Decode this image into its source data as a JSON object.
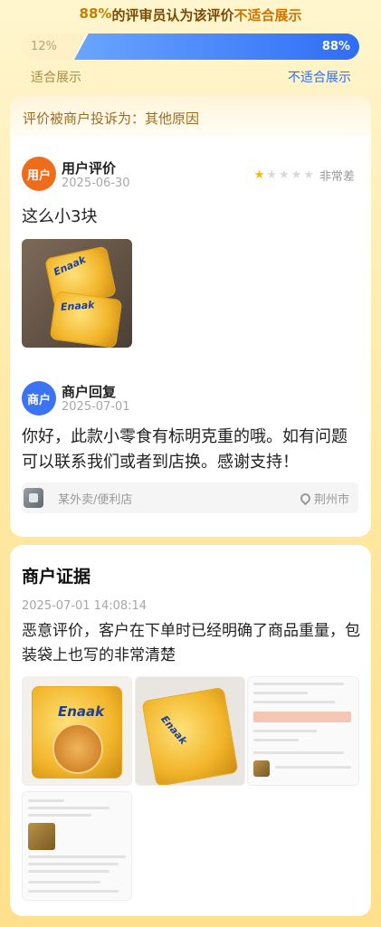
{
  "summary": {
    "percent": "88%",
    "middle": "的评审员认为该评价",
    "verdict": "不适合展示"
  },
  "vote": {
    "suitable_percent": "12%",
    "unsuitable_percent": "88%",
    "suitable_fraction": 0.12,
    "unsuitable_fraction": 0.88,
    "suitable_label": "适合展示",
    "unsuitable_label": "不适合展示",
    "left_color": "#fff1c7",
    "right_color": "#2f6df5"
  },
  "complaint": {
    "header": "评价被商户投诉为：其他原因"
  },
  "user_review": {
    "avatar_text": "用户",
    "title": "用户评价",
    "date": "2025-06-30",
    "rating": 1,
    "rating_max": 5,
    "rating_text": "非常差",
    "text": "这么小3块",
    "photo_icon": "snack-pack-photo"
  },
  "merchant_reply": {
    "avatar_text": "商户",
    "title": "商户回复",
    "date": "2025-07-01",
    "text": "你好，此款小零食有标明克重的哦。如有问题可以联系我们或者到店换。感谢支持！"
  },
  "store": {
    "name": "某外卖/便利店",
    "location": "荆州市",
    "location_icon": "map-pin-icon"
  },
  "evidence": {
    "title": "商户证据",
    "timestamp": "2025-07-01 14:08:14",
    "text": "恶意评价，客户在下单时已经明确了商品重量，包装袋上也写的非常清楚",
    "images": [
      {
        "kind": "product-photo",
        "brand": "Enaak"
      },
      {
        "kind": "product-photo",
        "brand": "Enaak"
      },
      {
        "kind": "order-screenshot"
      },
      {
        "kind": "review-screenshot"
      }
    ]
  }
}
